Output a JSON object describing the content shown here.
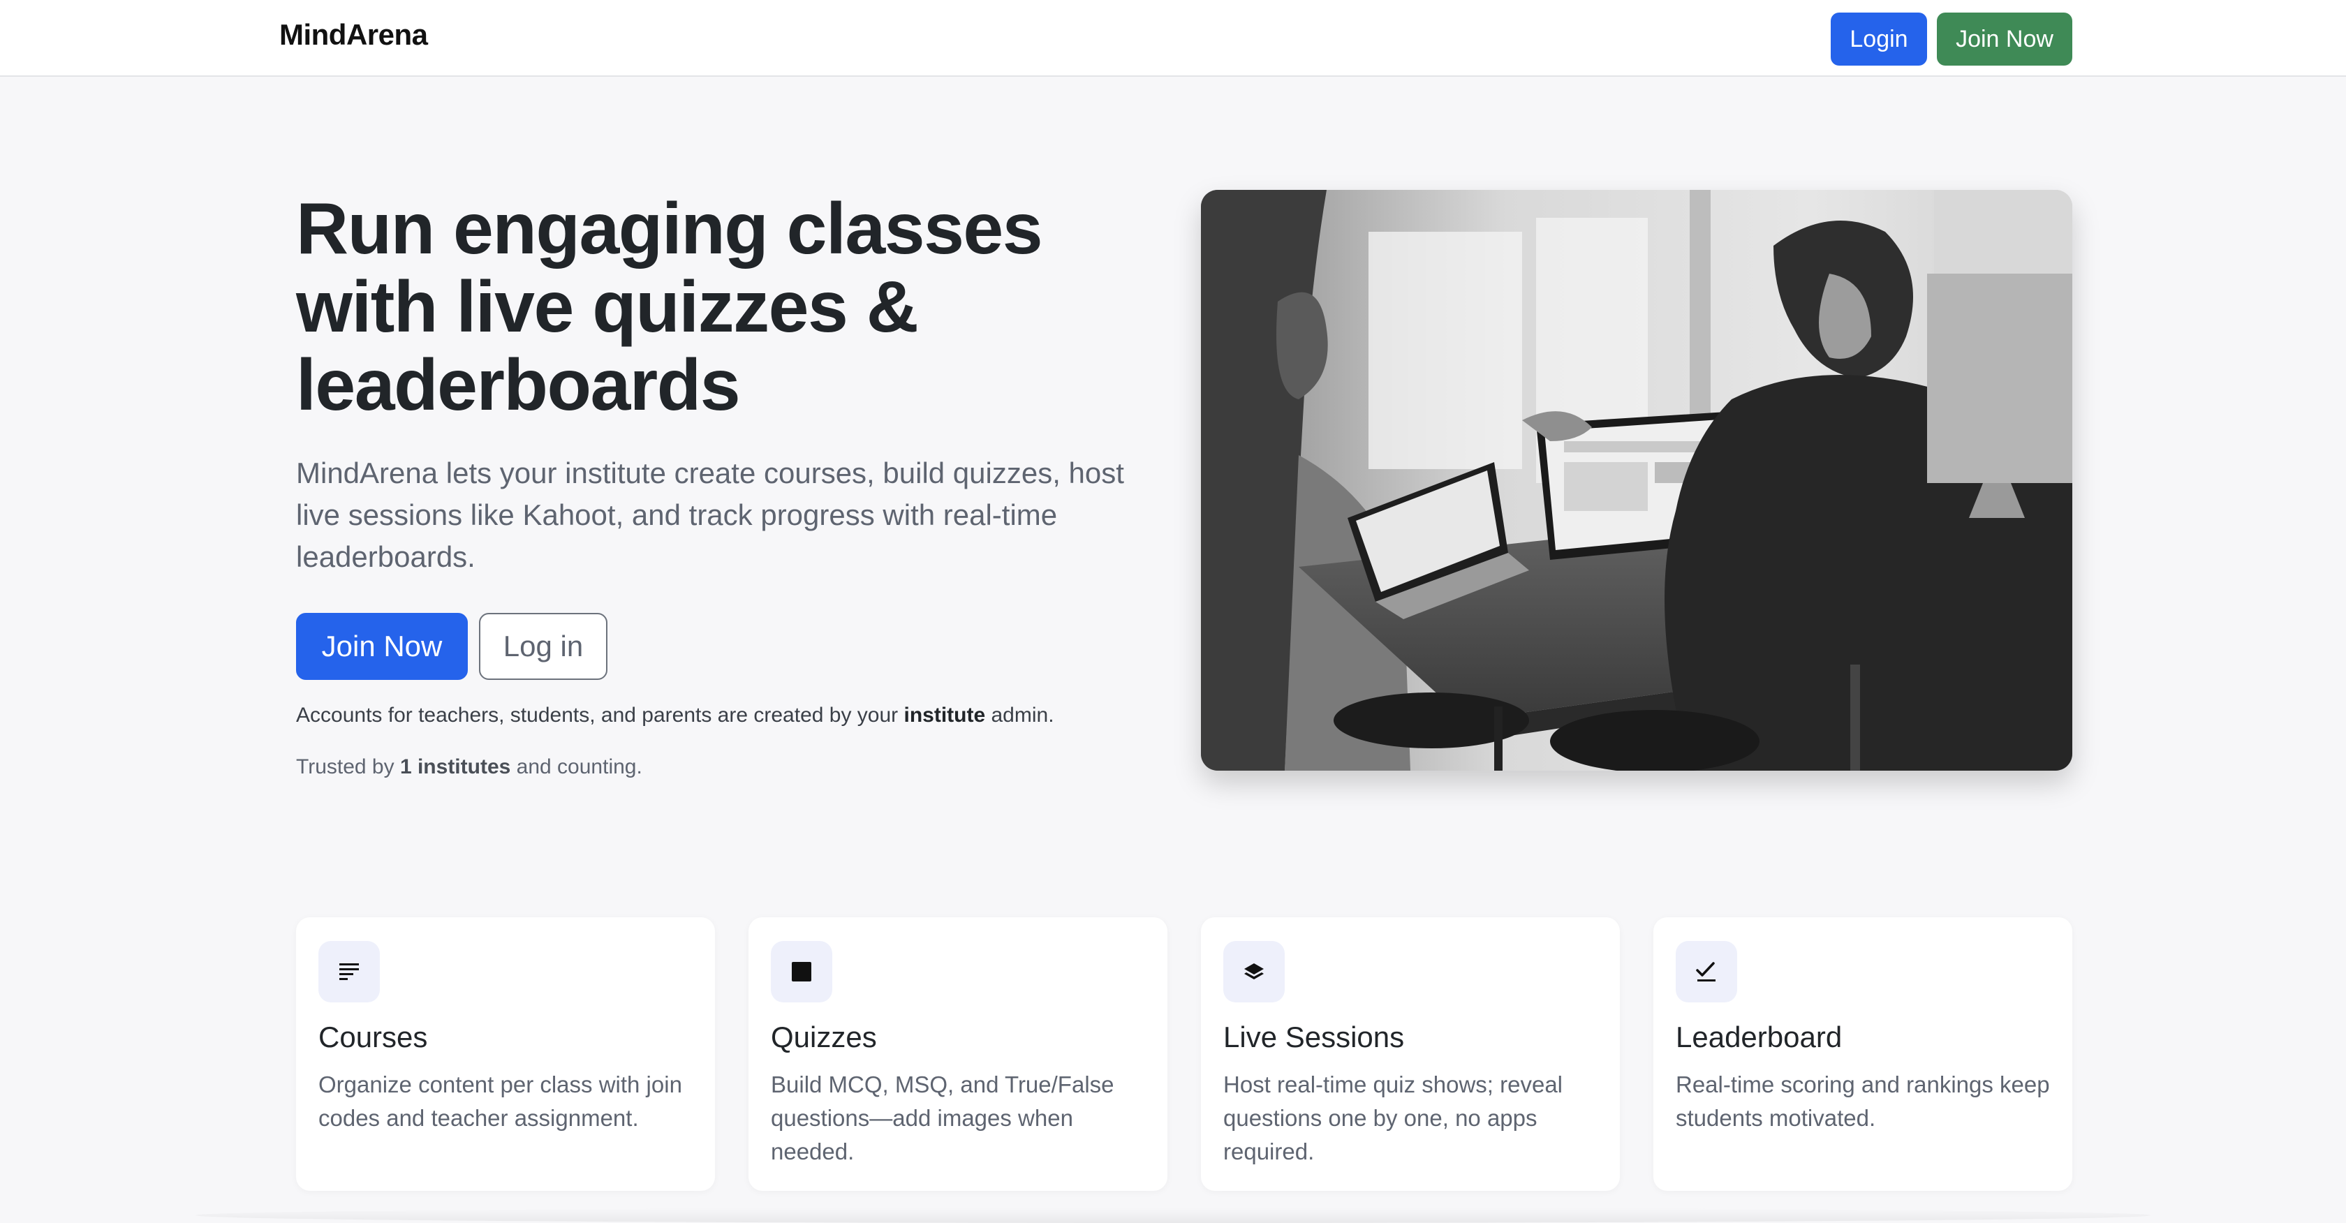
{
  "navbar": {
    "brand": "MindArena",
    "login_label": "Login",
    "join_label": "Join Now"
  },
  "hero": {
    "title": "Run engaging classes with live quizzes & leaderboards",
    "subtitle": "MindArena lets your institute create courses, build quizzes, host live sessions like Kahoot, and track progress with real-time leaderboards.",
    "join_label": "Join Now",
    "login_label": "Log in",
    "note_prefix": "Accounts for teachers, students, and parents are created by your ",
    "note_bold": "institute",
    "note_suffix": " admin.",
    "trusted_prefix": "Trusted by ",
    "trusted_bold": "1 institutes",
    "trusted_suffix": " and counting."
  },
  "features": [
    {
      "icon": "text-lines-icon",
      "title": "Courses",
      "description": "Organize content per class with join codes and teacher assignment."
    },
    {
      "icon": "square-icon",
      "title": "Quizzes",
      "description": "Build MCQ, MSQ, and True/False questions—add images when needed."
    },
    {
      "icon": "layers-icon",
      "title": "Live Sessions",
      "description": "Host real-time quiz shows; reveal questions one by one, no apps required."
    },
    {
      "icon": "check-icon",
      "title": "Leaderboard",
      "description": "Real-time scoring and rankings keep students motivated."
    }
  ],
  "colors": {
    "primary": "#2563eb",
    "join_green": "#3f8a56",
    "icon_bg": "#eef0fb"
  }
}
